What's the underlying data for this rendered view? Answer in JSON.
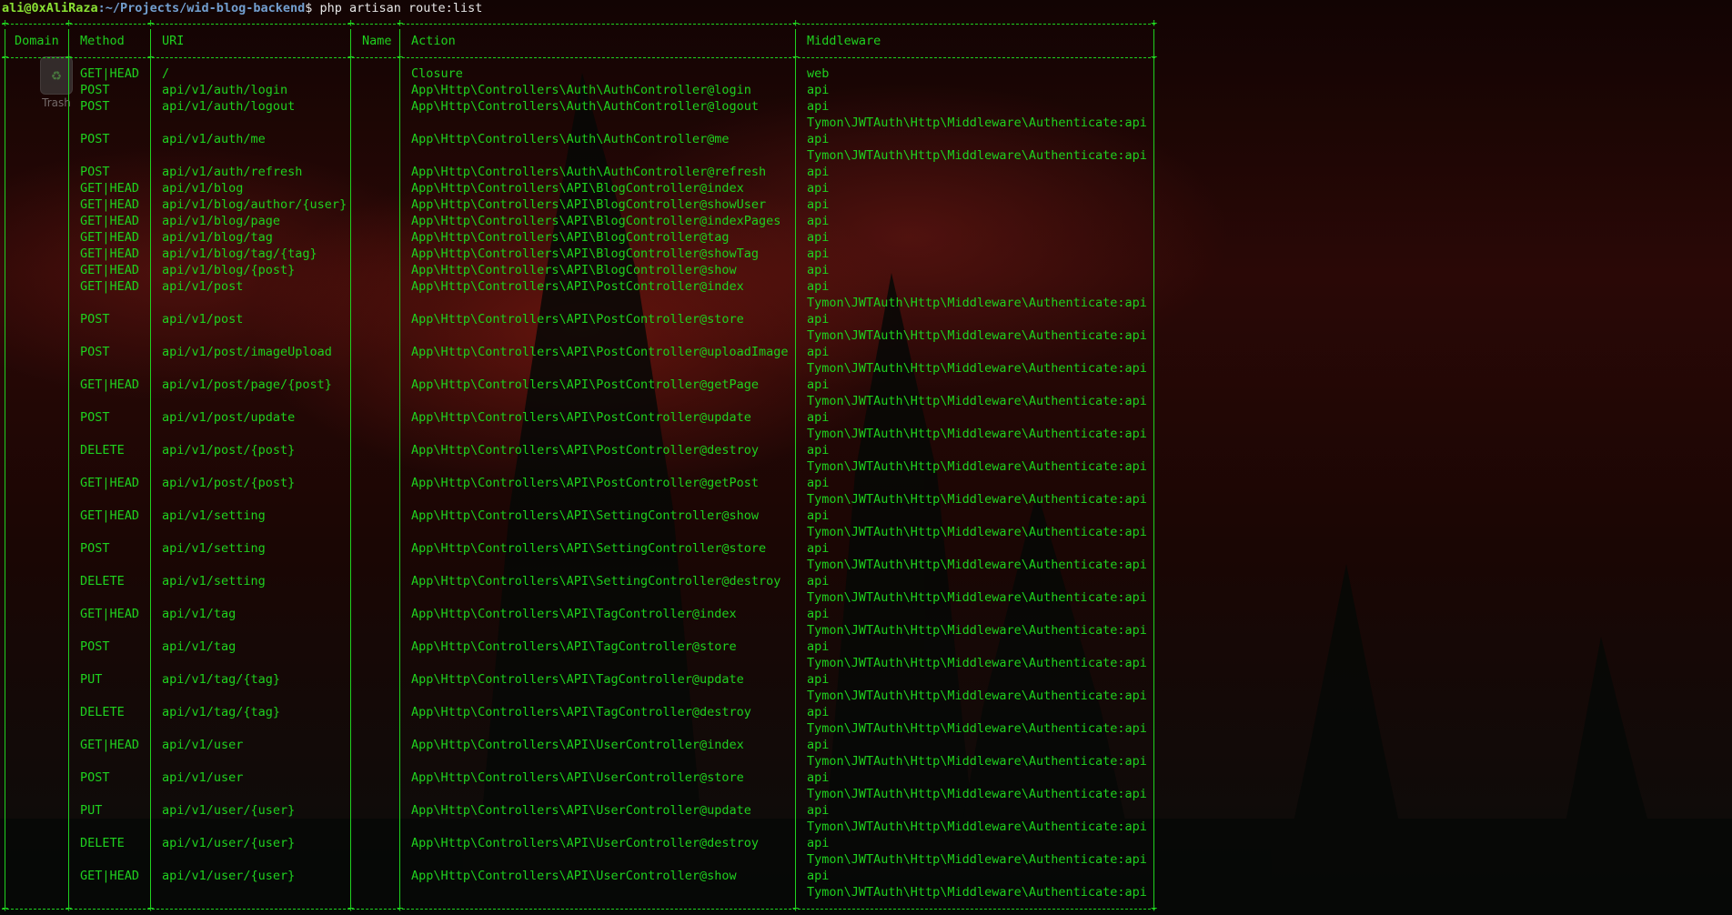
{
  "desktop": {
    "trash_label": "Trash",
    "partial_label": "ali"
  },
  "prompt": {
    "user_host": "ali@0xAliRaza",
    "path": ":~/Projects/wid-blog-backend",
    "symbol": "$ ",
    "command": "php artisan route:list"
  },
  "table": {
    "headers": [
      "Domain",
      "Method",
      "URI",
      "Name",
      "Action",
      "Middleware"
    ],
    "rows": [
      {
        "method": "GET|HEAD",
        "uri": "/",
        "action": "Closure",
        "mw": [
          "web"
        ]
      },
      {
        "method": "POST",
        "uri": "api/v1/auth/login",
        "action": "App\\Http\\Controllers\\Auth\\AuthController@login",
        "mw": [
          "api"
        ]
      },
      {
        "method": "POST",
        "uri": "api/v1/auth/logout",
        "action": "App\\Http\\Controllers\\Auth\\AuthController@logout",
        "mw": [
          "api",
          "Tymon\\JWTAuth\\Http\\Middleware\\Authenticate:api"
        ]
      },
      {
        "method": "POST",
        "uri": "api/v1/auth/me",
        "action": "App\\Http\\Controllers\\Auth\\AuthController@me",
        "mw": [
          "api",
          "Tymon\\JWTAuth\\Http\\Middleware\\Authenticate:api"
        ]
      },
      {
        "method": "POST",
        "uri": "api/v1/auth/refresh",
        "action": "App\\Http\\Controllers\\Auth\\AuthController@refresh",
        "mw": [
          "api"
        ]
      },
      {
        "method": "GET|HEAD",
        "uri": "api/v1/blog",
        "action": "App\\Http\\Controllers\\API\\BlogController@index",
        "mw": [
          "api"
        ]
      },
      {
        "method": "GET|HEAD",
        "uri": "api/v1/blog/author/{user}",
        "action": "App\\Http\\Controllers\\API\\BlogController@showUser",
        "mw": [
          "api"
        ]
      },
      {
        "method": "GET|HEAD",
        "uri": "api/v1/blog/page",
        "action": "App\\Http\\Controllers\\API\\BlogController@indexPages",
        "mw": [
          "api"
        ]
      },
      {
        "method": "GET|HEAD",
        "uri": "api/v1/blog/tag",
        "action": "App\\Http\\Controllers\\API\\BlogController@tag",
        "mw": [
          "api"
        ]
      },
      {
        "method": "GET|HEAD",
        "uri": "api/v1/blog/tag/{tag}",
        "action": "App\\Http\\Controllers\\API\\BlogController@showTag",
        "mw": [
          "api"
        ]
      },
      {
        "method": "GET|HEAD",
        "uri": "api/v1/blog/{post}",
        "action": "App\\Http\\Controllers\\API\\BlogController@show",
        "mw": [
          "api"
        ]
      },
      {
        "method": "GET|HEAD",
        "uri": "api/v1/post",
        "action": "App\\Http\\Controllers\\API\\PostController@index",
        "mw": [
          "api",
          "Tymon\\JWTAuth\\Http\\Middleware\\Authenticate:api"
        ]
      },
      {
        "method": "POST",
        "uri": "api/v1/post",
        "action": "App\\Http\\Controllers\\API\\PostController@store",
        "mw": [
          "api",
          "Tymon\\JWTAuth\\Http\\Middleware\\Authenticate:api"
        ]
      },
      {
        "method": "POST",
        "uri": "api/v1/post/imageUpload",
        "action": "App\\Http\\Controllers\\API\\PostController@uploadImage",
        "mw": [
          "api",
          "Tymon\\JWTAuth\\Http\\Middleware\\Authenticate:api"
        ]
      },
      {
        "method": "GET|HEAD",
        "uri": "api/v1/post/page/{post}",
        "action": "App\\Http\\Controllers\\API\\PostController@getPage",
        "mw": [
          "api",
          "Tymon\\JWTAuth\\Http\\Middleware\\Authenticate:api"
        ]
      },
      {
        "method": "POST",
        "uri": "api/v1/post/update",
        "action": "App\\Http\\Controllers\\API\\PostController@update",
        "mw": [
          "api",
          "Tymon\\JWTAuth\\Http\\Middleware\\Authenticate:api"
        ]
      },
      {
        "method": "DELETE",
        "uri": "api/v1/post/{post}",
        "action": "App\\Http\\Controllers\\API\\PostController@destroy",
        "mw": [
          "api",
          "Tymon\\JWTAuth\\Http\\Middleware\\Authenticate:api"
        ]
      },
      {
        "method": "GET|HEAD",
        "uri": "api/v1/post/{post}",
        "action": "App\\Http\\Controllers\\API\\PostController@getPost",
        "mw": [
          "api",
          "Tymon\\JWTAuth\\Http\\Middleware\\Authenticate:api"
        ]
      },
      {
        "method": "GET|HEAD",
        "uri": "api/v1/setting",
        "action": "App\\Http\\Controllers\\API\\SettingController@show",
        "mw": [
          "api",
          "Tymon\\JWTAuth\\Http\\Middleware\\Authenticate:api"
        ]
      },
      {
        "method": "POST",
        "uri": "api/v1/setting",
        "action": "App\\Http\\Controllers\\API\\SettingController@store",
        "mw": [
          "api",
          "Tymon\\JWTAuth\\Http\\Middleware\\Authenticate:api"
        ]
      },
      {
        "method": "DELETE",
        "uri": "api/v1/setting",
        "action": "App\\Http\\Controllers\\API\\SettingController@destroy",
        "mw": [
          "api",
          "Tymon\\JWTAuth\\Http\\Middleware\\Authenticate:api"
        ]
      },
      {
        "method": "GET|HEAD",
        "uri": "api/v1/tag",
        "action": "App\\Http\\Controllers\\API\\TagController@index",
        "mw": [
          "api",
          "Tymon\\JWTAuth\\Http\\Middleware\\Authenticate:api"
        ]
      },
      {
        "method": "POST",
        "uri": "api/v1/tag",
        "action": "App\\Http\\Controllers\\API\\TagController@store",
        "mw": [
          "api",
          "Tymon\\JWTAuth\\Http\\Middleware\\Authenticate:api"
        ]
      },
      {
        "method": "PUT",
        "uri": "api/v1/tag/{tag}",
        "action": "App\\Http\\Controllers\\API\\TagController@update",
        "mw": [
          "api",
          "Tymon\\JWTAuth\\Http\\Middleware\\Authenticate:api"
        ]
      },
      {
        "method": "DELETE",
        "uri": "api/v1/tag/{tag}",
        "action": "App\\Http\\Controllers\\API\\TagController@destroy",
        "mw": [
          "api",
          "Tymon\\JWTAuth\\Http\\Middleware\\Authenticate:api"
        ]
      },
      {
        "method": "GET|HEAD",
        "uri": "api/v1/user",
        "action": "App\\Http\\Controllers\\API\\UserController@index",
        "mw": [
          "api",
          "Tymon\\JWTAuth\\Http\\Middleware\\Authenticate:api"
        ]
      },
      {
        "method": "POST",
        "uri": "api/v1/user",
        "action": "App\\Http\\Controllers\\API\\UserController@store",
        "mw": [
          "api",
          "Tymon\\JWTAuth\\Http\\Middleware\\Authenticate:api"
        ]
      },
      {
        "method": "PUT",
        "uri": "api/v1/user/{user}",
        "action": "App\\Http\\Controllers\\API\\UserController@update",
        "mw": [
          "api",
          "Tymon\\JWTAuth\\Http\\Middleware\\Authenticate:api"
        ]
      },
      {
        "method": "DELETE",
        "uri": "api/v1/user/{user}",
        "action": "App\\Http\\Controllers\\API\\UserController@destroy",
        "mw": [
          "api",
          "Tymon\\JWTAuth\\Http\\Middleware\\Authenticate:api"
        ]
      },
      {
        "method": "GET|HEAD",
        "uri": "api/v1/user/{user}",
        "action": "App\\Http\\Controllers\\API\\UserController@show",
        "mw": [
          "api",
          "Tymon\\JWTAuth\\Http\\Middleware\\Authenticate:api"
        ]
      }
    ]
  },
  "colors": {
    "terminal_text": "#1fd11f",
    "prompt_user": "#8ae234",
    "prompt_path": "#729fcf"
  }
}
